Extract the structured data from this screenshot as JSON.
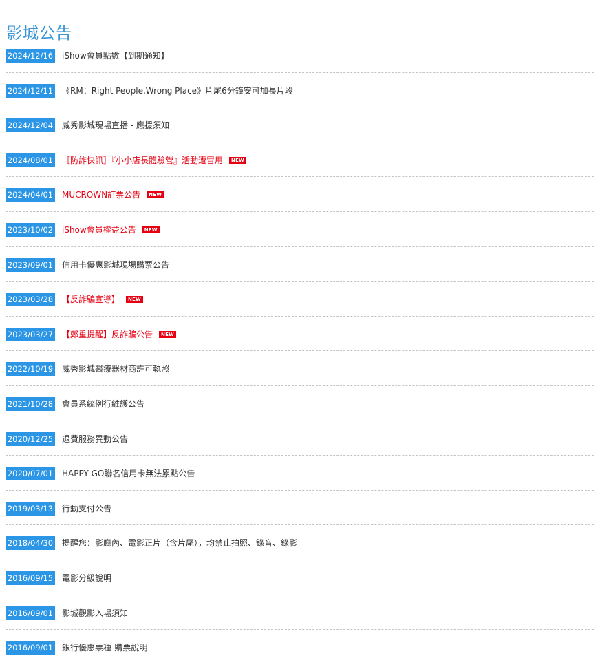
{
  "page": {
    "title": "影城公告"
  },
  "notices": [
    {
      "date": "2024/12/16",
      "title": "iShow會員點數【到期通知】",
      "highlight": false,
      "is_new": false
    },
    {
      "date": "2024/12/11",
      "title": "《RM：Right People,Wrong Place》片尾6分鐘安可加長片段",
      "highlight": false,
      "is_new": false
    },
    {
      "date": "2024/12/04",
      "title": "威秀影城現場直播 - 應援須知",
      "highlight": false,
      "is_new": false
    },
    {
      "date": "2024/08/01",
      "title": "［防詐快訊］『小小店長體驗營』活動遭冒用",
      "highlight": true,
      "is_new": true
    },
    {
      "date": "2024/04/01",
      "title": "MUCROWN訂票公告",
      "highlight": true,
      "is_new": true
    },
    {
      "date": "2023/10/02",
      "title": "iShow會員權益公告",
      "highlight": true,
      "is_new": true
    },
    {
      "date": "2023/09/01",
      "title": "信用卡優惠影城現場購票公告",
      "highlight": false,
      "is_new": false
    },
    {
      "date": "2023/03/28",
      "title": "【反詐騙宣導】",
      "highlight": true,
      "is_new": true
    },
    {
      "date": "2023/03/27",
      "title": "【鄭重提醒】反詐騙公告",
      "highlight": true,
      "is_new": true
    },
    {
      "date": "2022/10/19",
      "title": "威秀影城醫療器材商許可執照",
      "highlight": false,
      "is_new": false
    },
    {
      "date": "2021/10/28",
      "title": "會員系統例行維護公告",
      "highlight": false,
      "is_new": false
    },
    {
      "date": "2020/12/25",
      "title": "退費服務異動公告",
      "highlight": false,
      "is_new": false
    },
    {
      "date": "2020/07/01",
      "title": "HAPPY GO聯名信用卡無法累點公告",
      "highlight": false,
      "is_new": false
    },
    {
      "date": "2019/03/13",
      "title": "行動支付公告",
      "highlight": false,
      "is_new": false
    },
    {
      "date": "2018/04/30",
      "title": "提醒您：影廳內、電影正片（含片尾），均禁止拍照、錄音、錄影",
      "highlight": false,
      "is_new": false
    },
    {
      "date": "2016/09/15",
      "title": "電影分級說明",
      "highlight": false,
      "is_new": false
    },
    {
      "date": "2016/09/01",
      "title": "影城觀影入場須知",
      "highlight": false,
      "is_new": false
    },
    {
      "date": "2016/09/01",
      "title": "銀行優惠票種-購票說明",
      "highlight": false,
      "is_new": false
    }
  ],
  "labels": {
    "new_badge": "NEW"
  },
  "colors": {
    "title": "#3a94d6",
    "date_badge_bg": "#2b95e6",
    "highlight_text": "#e60012",
    "new_badge_bg": "#e60012",
    "normal_text": "#333333",
    "divider": "#c4c4c4"
  }
}
